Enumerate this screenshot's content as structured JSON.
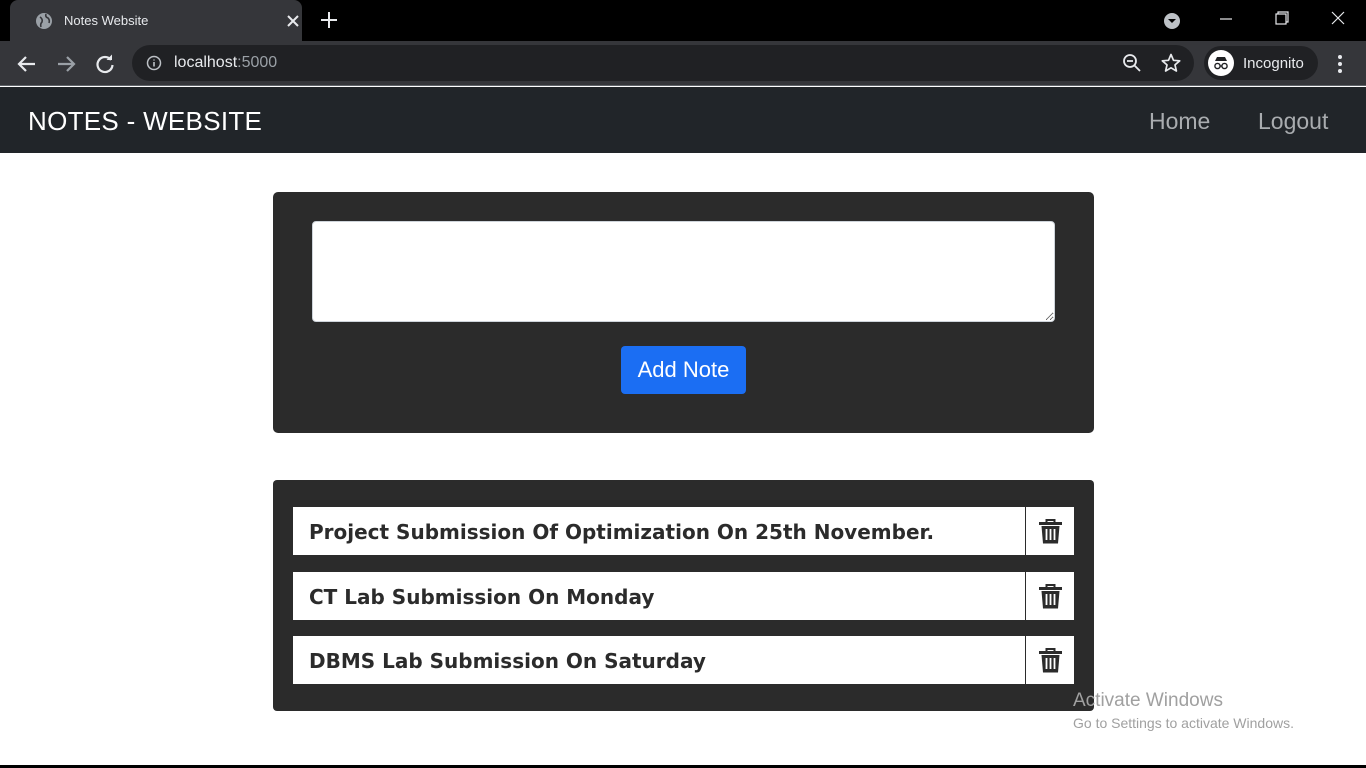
{
  "browser": {
    "tab_title": "Notes Website",
    "url_host": "localhost",
    "url_port": ":5000",
    "profile_label": "Incognito",
    "icons": [
      "globe-icon",
      "close-icon",
      "plus-icon",
      "tab-search-icon",
      "minimize-icon",
      "restore-icon",
      "window-close-icon",
      "back-arrow-icon",
      "forward-arrow-icon",
      "reload-icon",
      "info-icon",
      "zoom-out-icon",
      "star-icon",
      "incognito-icon",
      "kebab-menu-icon"
    ]
  },
  "navbar": {
    "brand": "NOTES - WEBSITE",
    "links": [
      "Home",
      "Logout"
    ]
  },
  "add_note": {
    "input_value": "",
    "button_label": "Add Note"
  },
  "notes": [
    "Project Submission Of Optimization On 25th November.",
    "CT Lab Submission On Monday",
    "DBMS Lab Submission On Saturday"
  ],
  "watermark": {
    "title": "Activate Windows",
    "subtitle": "Go to Settings to activate Windows."
  },
  "colors": {
    "navbar_bg": "#212529",
    "card_bg": "#2b2b2b",
    "button_blue": "#1b6ef3"
  }
}
